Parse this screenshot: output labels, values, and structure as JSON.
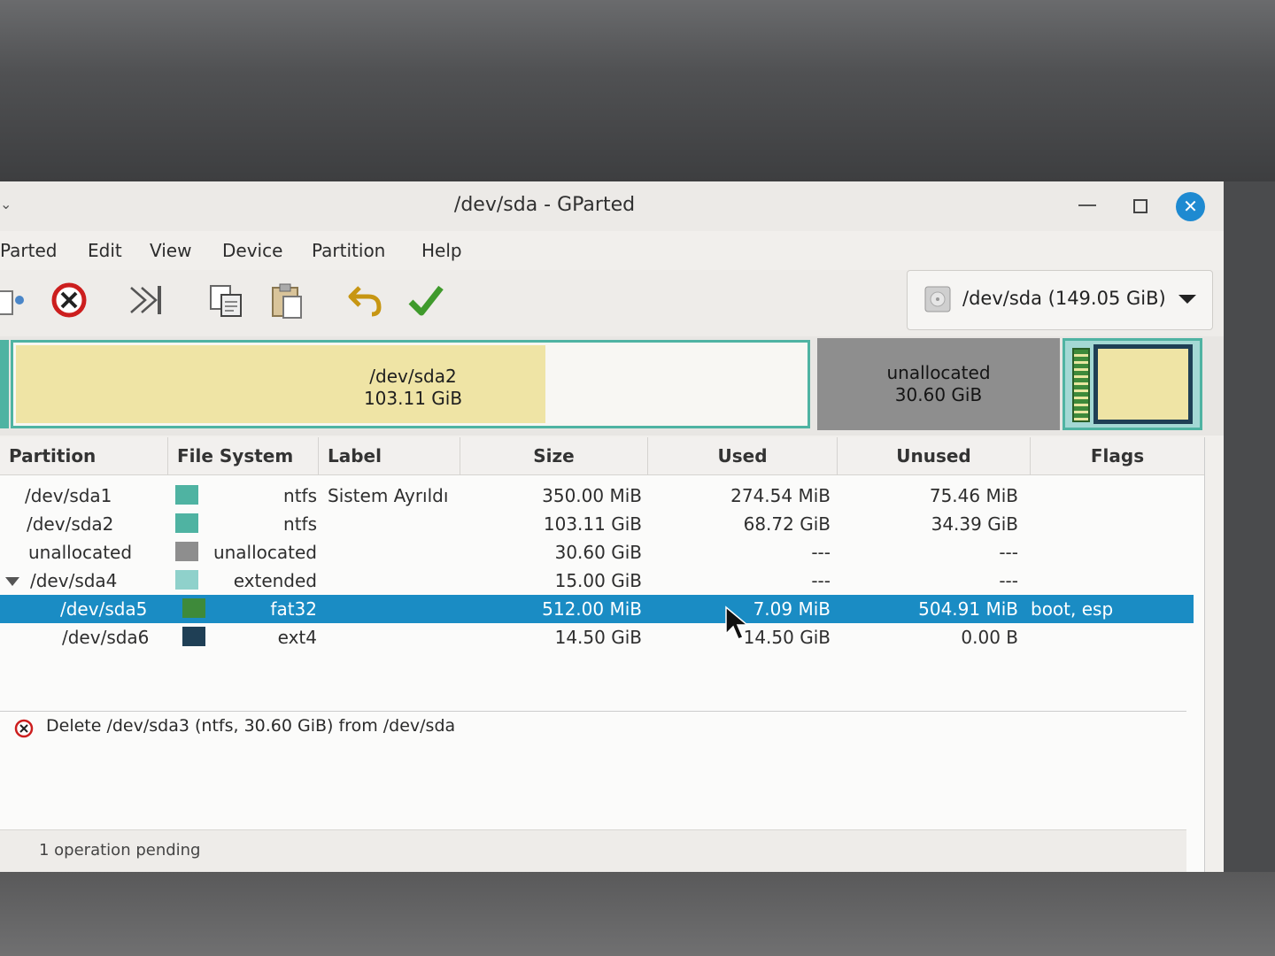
{
  "window": {
    "title": "/dev/sda - GParted",
    "close_glyph": "✕"
  },
  "menubar": [
    "GParted",
    "Edit",
    "View",
    "Device",
    "Partition",
    "Help"
  ],
  "menubar_visible": [
    "Parted",
    "Edit",
    "View",
    "Device",
    "Partition",
    "Help"
  ],
  "toolbar": {
    "icons": [
      "new-partition-icon",
      "delete-icon",
      "resize-move-icon",
      "copy-icon",
      "paste-icon",
      "undo-icon",
      "apply-icon"
    ]
  },
  "device_selector": {
    "value": "/dev/sda  (149.05 GiB)"
  },
  "disk_map": {
    "sda2": {
      "name": "/dev/sda2",
      "size": "103.11 GiB",
      "used_fraction": 0.667
    },
    "unallocated": {
      "name": "unallocated",
      "size": "30.60 GiB"
    }
  },
  "table": {
    "headers": [
      "Partition",
      "File System",
      "Label",
      "Size",
      "Used",
      "Unused",
      "Flags"
    ],
    "rows": [
      {
        "partition": "/dev/sda1",
        "fs": "ntfs",
        "label": "Sistem Ayrıldı",
        "size": "350.00 MiB",
        "used": "274.54 MiB",
        "unused": "75.46 MiB",
        "flags": "",
        "color": "#4fb3a2"
      },
      {
        "partition": "/dev/sda2",
        "fs": "ntfs",
        "label": "",
        "size": "103.11 GiB",
        "used": "68.72 GiB",
        "unused": "34.39 GiB",
        "flags": "",
        "color": "#4fb3a2"
      },
      {
        "partition": "unallocated",
        "fs": "unallocated",
        "label": "",
        "size": "30.60 GiB",
        "used": "---",
        "unused": "---",
        "flags": "",
        "color": "#8e8e8e"
      },
      {
        "partition": "/dev/sda4",
        "fs": "extended",
        "label": "",
        "size": "15.00 GiB",
        "used": "---",
        "unused": "---",
        "flags": "",
        "color": "#8fd1cb"
      },
      {
        "partition": "/dev/sda5",
        "fs": "fat32",
        "label": "",
        "size": "512.00 MiB",
        "used": "7.09 MiB",
        "unused": "504.91 MiB",
        "flags": "boot, esp",
        "color": "#3e8a3a"
      },
      {
        "partition": "/dev/sda6",
        "fs": "ext4",
        "label": "",
        "size": "14.50 GiB",
        "used": "14.50 GiB",
        "unused": "0.00 B",
        "flags": "",
        "color": "#1f3f55"
      }
    ]
  },
  "operations": [
    "Delete /dev/sda3 (ntfs, 30.60 GiB) from /dev/sda"
  ],
  "status": "1 operation pending",
  "colors": {
    "accent": "#1a8cc4",
    "ntfs": "#4fb3a2",
    "unallocated": "#8e8e8e",
    "fat32": "#3e8a3a",
    "ext4": "#1f3f55"
  }
}
